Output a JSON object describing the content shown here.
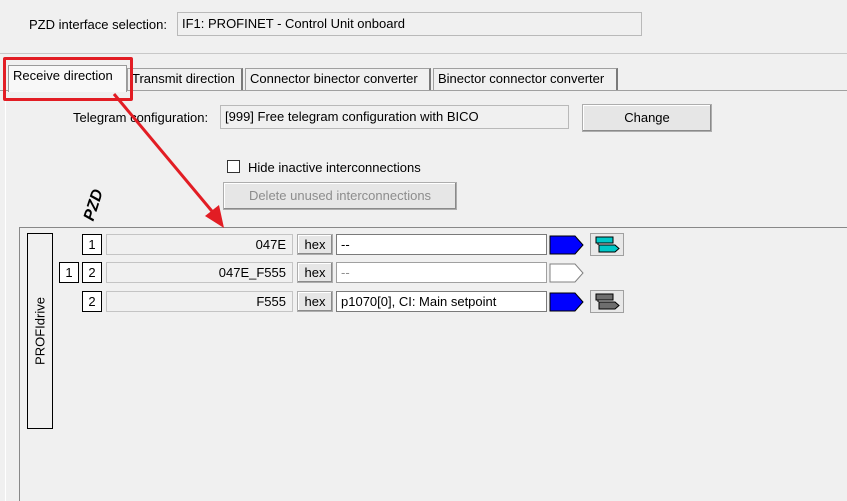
{
  "header": {
    "pzd_interface_label": "PZD interface selection:",
    "pzd_interface_value": "IF1:  PROFINET - Control Unit onboard"
  },
  "tabs": [
    {
      "label": "Receive direction",
      "active": true
    },
    {
      "label": "Transmit direction",
      "active": false
    },
    {
      "label": "Connector binector converter",
      "active": false
    },
    {
      "label": "Binector connector converter",
      "active": false
    }
  ],
  "telegram": {
    "label": "Telegram configuration:",
    "value": "[999] Free telegram configuration with BICO",
    "change_label": "Change"
  },
  "options": {
    "hide_inactive_label": "Hide inactive interconnections",
    "hide_inactive_checked": false,
    "delete_unused_label": "Delete unused interconnections"
  },
  "pzd_header": "PZD",
  "profidrive_label": "PROFIdrive",
  "rows": [
    {
      "index_outer": "",
      "index": "1",
      "value": "047E",
      "hex_label": "hex",
      "param": "--",
      "active": true
    },
    {
      "index_outer": "1",
      "index": "2",
      "value": "047E_F555",
      "hex_label": "hex",
      "param": "--",
      "active": false
    },
    {
      "index_outer": "",
      "index": "2",
      "value": "F555",
      "hex_label": "hex",
      "param": "p1070[0], CI: Main setpoint",
      "active": true
    }
  ],
  "colors": {
    "arrow_active": "#0000ff",
    "arrow_inactive": "#ffffff",
    "tool_active_1": "#00c8c8",
    "tool_active_3": "#6e6e6e",
    "highlight": "#e21d24"
  }
}
